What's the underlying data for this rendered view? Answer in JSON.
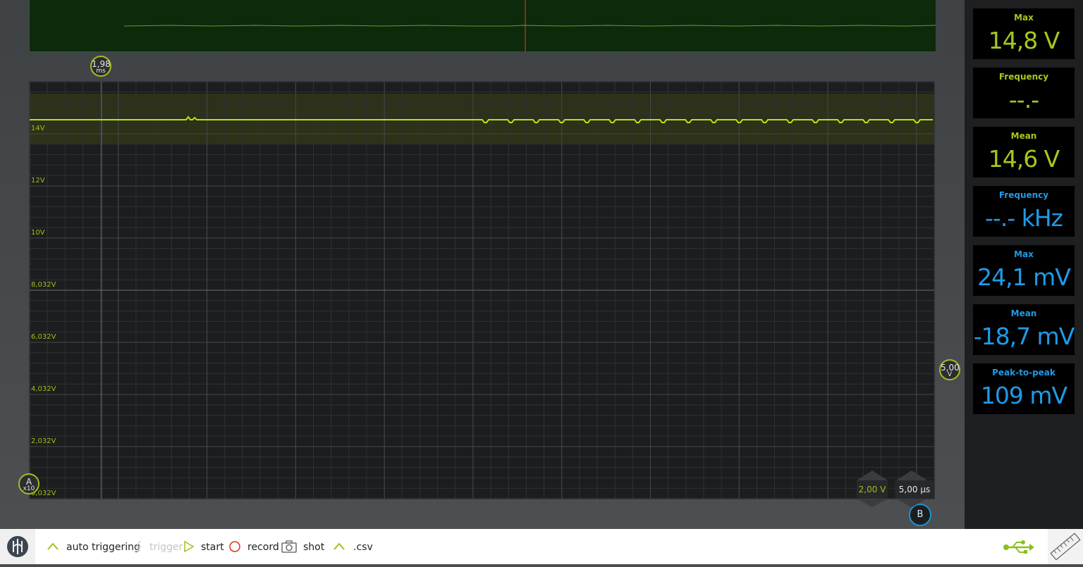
{
  "overview": {
    "cursor_color": "#e23d2c",
    "trace_color": "#6e9a2a"
  },
  "main_plot": {
    "trace_color": "#b9e01a",
    "y_labels": [
      "14V",
      "12V",
      "10V",
      "8,032V",
      "6,032V",
      "4,032V",
      "2,032V",
      "0,032V"
    ]
  },
  "markers": {
    "time_cursor": {
      "value": "1,98",
      "unit": "ms"
    },
    "channel_a": {
      "letter": "A",
      "scale": "x10"
    },
    "offset": {
      "value": "5,00",
      "unit": "V"
    },
    "channel_b": {
      "letter": "B"
    }
  },
  "scales": {
    "voltage": "2,00 V",
    "time": "5,00 µs"
  },
  "measurements": [
    {
      "label": "Max",
      "value": "14,8 V",
      "channel": "A"
    },
    {
      "label": "Frequency",
      "value": "--.-",
      "channel": "A"
    },
    {
      "label": "Mean",
      "value": "14,6 V",
      "channel": "A"
    },
    {
      "label": "Frequency",
      "value": "--.- kHz",
      "channel": "B"
    },
    {
      "label": "Max",
      "value": "24,1 mV",
      "channel": "B"
    },
    {
      "label": "Mean",
      "value": "-18,7 mV",
      "channel": "B"
    },
    {
      "label": "Peak-to-peak",
      "value": "109 mV",
      "channel": "B"
    }
  ],
  "colors": {
    "channel_a": "#a5c81e",
    "channel_b": "#1e9be8"
  },
  "toolbar": {
    "logo_icon": "app-logo-icon",
    "auto_triggering": "auto triggering",
    "trigger": "trigger",
    "start": "start",
    "record": "record",
    "shot": "shot",
    "csv": ".csv",
    "usb_icon": "usb-icon",
    "ruler_icon": "ruler-icon"
  }
}
